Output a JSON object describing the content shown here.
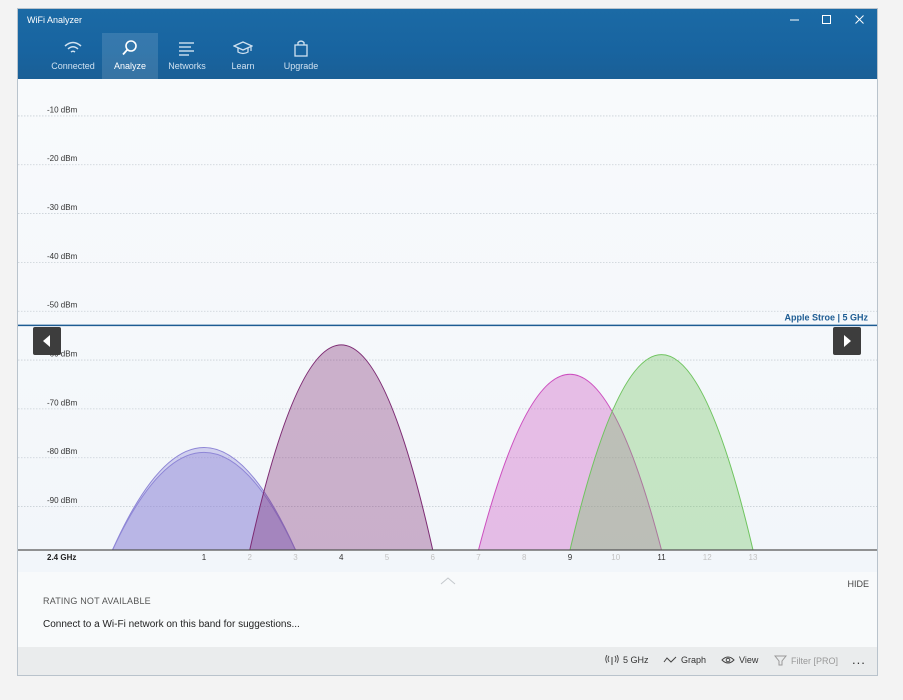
{
  "app": {
    "title": "WiFi Analyzer"
  },
  "tabs": [
    {
      "label": "Connected",
      "icon": "wifi-icon"
    },
    {
      "label": "Analyze",
      "icon": "magnifier-icon"
    },
    {
      "label": "Networks",
      "icon": "list-icon"
    },
    {
      "label": "Learn",
      "icon": "graduation-cap-icon"
    },
    {
      "label": "Upgrade",
      "icon": "shopping-bag-icon"
    }
  ],
  "chart_data": {
    "type": "area",
    "y_tick_labels": [
      "-10 dBm",
      "-20 dBm",
      "-30 dBm",
      "-40 dBm",
      "-50 dBm",
      "-60 dBm",
      "-70 dBm",
      "-80 dBm",
      "-90 dBm"
    ],
    "ylim": [
      -99,
      -5
    ],
    "x_axis_label": "2.4 GHz",
    "channels": [
      "1",
      "2",
      "3",
      "4",
      "5",
      "6",
      "7",
      "8",
      "9",
      "10",
      "11",
      "12",
      "13"
    ],
    "active_channels": [
      "1",
      "4",
      "9",
      "11"
    ],
    "highlight_label": "Apple Stroe | 5 GHz",
    "highlight_dbm": -53,
    "networks": [
      {
        "channel": 1,
        "channel_start": -1,
        "channel_end": 3,
        "peak_dbm": -78,
        "color": "#8e86d6"
      },
      {
        "channel": 1,
        "channel_start": -1,
        "channel_end": 3,
        "peak_dbm": -79,
        "color": "#8e86d6"
      },
      {
        "channel": 4,
        "channel_start": 2,
        "channel_end": 6,
        "peak_dbm": -57,
        "color": "#7d2b73"
      },
      {
        "channel": 9,
        "channel_start": 7,
        "channel_end": 11,
        "peak_dbm": -63,
        "color": "#cc4fbf"
      },
      {
        "channel": 11,
        "channel_start": 9,
        "channel_end": 13,
        "peak_dbm": -59,
        "color": "#6fc45f"
      }
    ],
    "grid": true
  },
  "bottom": {
    "hide_label": "HIDE",
    "rating": "RATING NOT AVAILABLE",
    "suggestion": "Connect to a Wi-Fi network on this band for suggestions..."
  },
  "statusbar": {
    "band": "5 GHz",
    "graph": "Graph",
    "view": "View",
    "filter": "Filter [PRO]",
    "more": "..."
  },
  "colors": {
    "accent": "#1864a0",
    "highlight": "#1d5c93"
  }
}
